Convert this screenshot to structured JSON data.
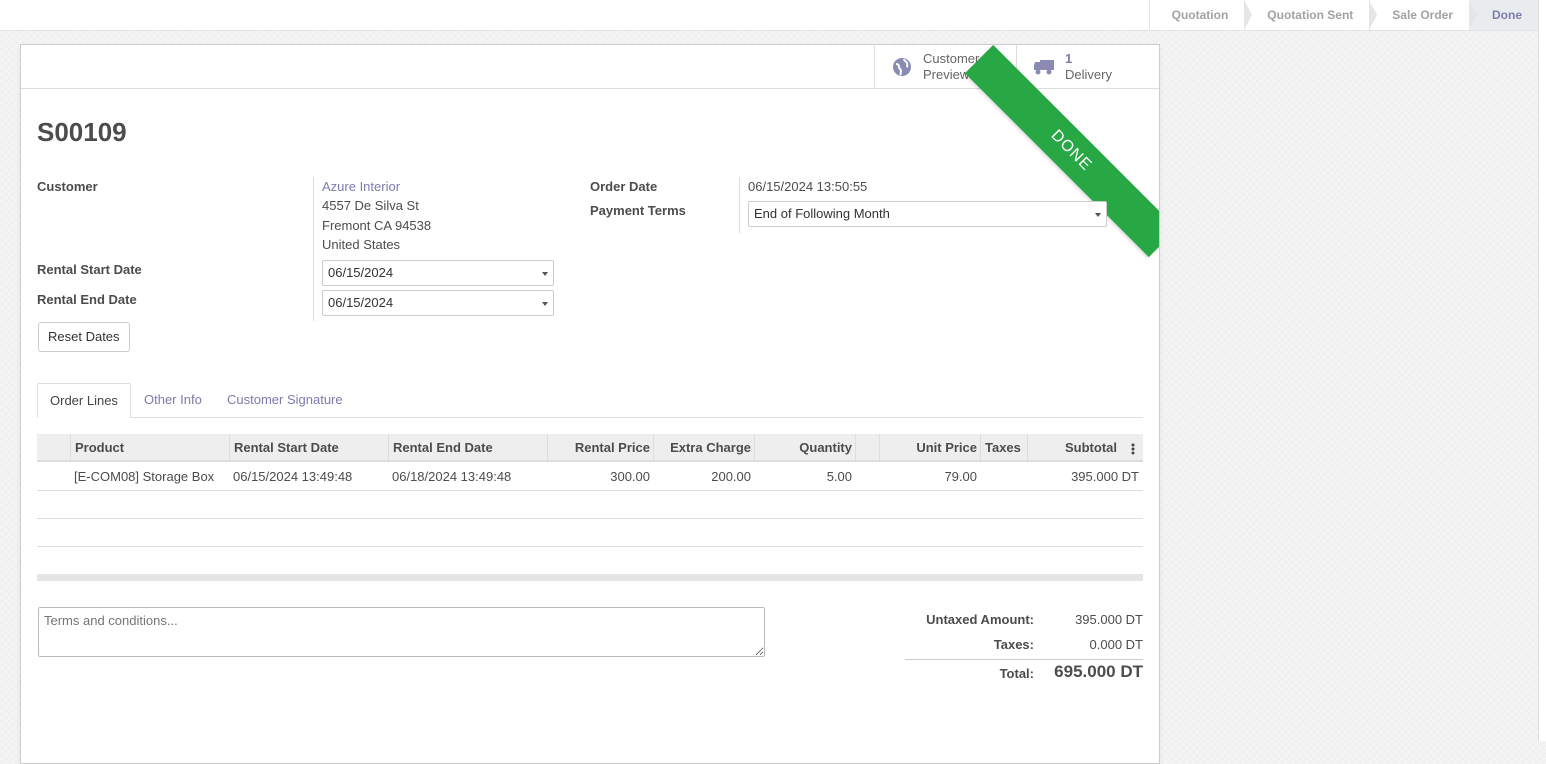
{
  "statusbar": {
    "stages": [
      "Quotation",
      "Quotation Sent",
      "Sale Order",
      "Done"
    ],
    "active_stage": "Done"
  },
  "smart_buttons": {
    "preview": {
      "line1": "Customer",
      "line2": "Preview",
      "icon": "globe-icon"
    },
    "delivery": {
      "count": "1",
      "label": "Delivery",
      "icon": "truck-icon"
    }
  },
  "ribbon": {
    "text": "DONE",
    "color": "#28a745"
  },
  "order": {
    "name": "S00109",
    "customer_label": "Customer",
    "customer_name": "Azure Interior",
    "address_line1": "4557 De Silva St",
    "address_line2": "Fremont CA 94538",
    "address_line3": "United States",
    "rental_start_label": "Rental Start Date",
    "rental_start_value": "06/15/2024",
    "rental_end_label": "Rental End Date",
    "rental_end_value": "06/15/2024",
    "reset_dates_label": "Reset Dates",
    "order_date_label": "Order Date",
    "order_date_value": "06/15/2024 13:50:55",
    "payment_terms_label": "Payment Terms",
    "payment_terms_value": "End of Following Month"
  },
  "tabs": [
    "Order Lines",
    "Other Info",
    "Customer Signature"
  ],
  "table": {
    "columns": [
      "Product",
      "Rental Start Date",
      "Rental End Date",
      "Rental Price",
      "Extra Charge",
      "Quantity",
      "Unit Price",
      "Taxes",
      "Subtotal"
    ],
    "rows": [
      {
        "product": "[E-COM08] Storage Box",
        "start": "06/15/2024 13:49:48",
        "end": "06/18/2024 13:49:48",
        "rental_price": "300.00",
        "extra_charge": "200.00",
        "quantity": "5.00",
        "unit_price": "79.00",
        "taxes": "",
        "subtotal": "395.000 DT"
      }
    ]
  },
  "terms_placeholder": "Terms and conditions...",
  "totals": {
    "untaxed_label": "Untaxed Amount:",
    "untaxed_value": "395.000 DT",
    "taxes_label": "Taxes:",
    "taxes_value": "0.000 DT",
    "total_label": "Total:",
    "total_value": "695.000 DT"
  },
  "colors": {
    "accent": "#7c7bad",
    "done_green": "#28a745"
  }
}
